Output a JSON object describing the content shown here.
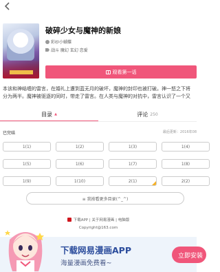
{
  "header": {
    "title": "破碎少女与魔神的新娘",
    "author": "彩纱小蝴蝶",
    "tags": "战斗 魔幻 玄幻 恋爱",
    "read_button": "观看第一话"
  },
  "description": {
    "line1": "本该和神结缠的雷言，在婚礼上遭到蓝无月的破坏，魔神的封印也被打破。神一怒之下将",
    "line2": "分为两半。魔神被驱逐的同时，带走了雷言。在人类与魔神的对抗中，雷言认识了一个又"
  },
  "tabs": [
    {
      "label": "目录",
      "indicator": "▲"
    },
    {
      "label": "评论",
      "count": "250"
    }
  ],
  "chapters_section": {
    "status": "已完结",
    "update": "最后更新：2016年08",
    "chapters": [
      "1(1)",
      "1(2)",
      "1(3)",
      "1(4)",
      "1(5)",
      "1(6)",
      "1(7)",
      "1(8)",
      "1(9)",
      "1(10)",
      "2(1)",
      "2(2)"
    ],
    "more_button": "≡ 我按看更多目录(^_^)"
  },
  "footer": {
    "links": "下载APP | 关于网易漫画 | 电脑版",
    "copyright": "Copyright@163.com"
  },
  "banner": {
    "title": "下载网易漫画APP",
    "subtitle": "海量漫画免费看~",
    "button": "立即安装"
  },
  "colors": {
    "accent": "#f0567a",
    "banner_text": "#2b4c9c",
    "badge": "#f5b025"
  }
}
